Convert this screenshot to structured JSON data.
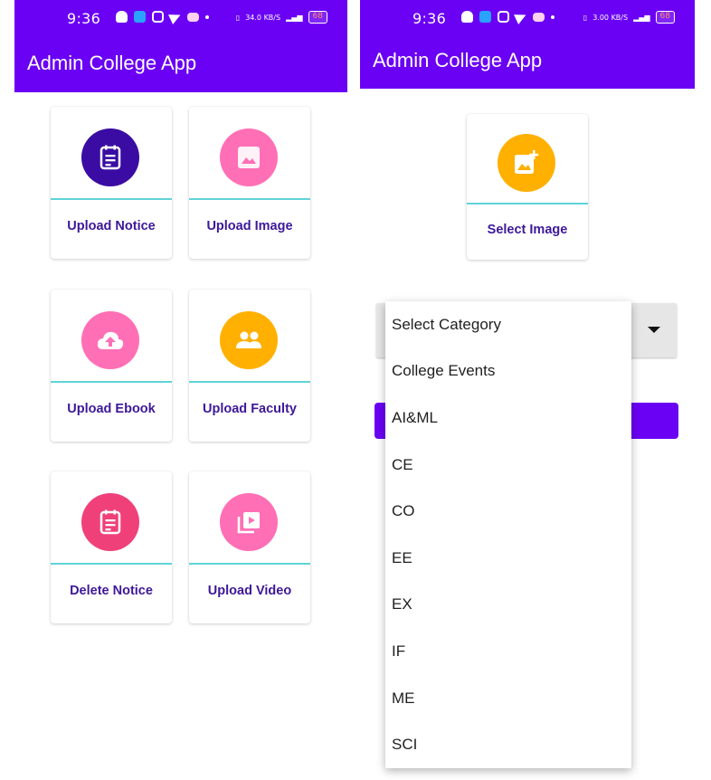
{
  "left": {
    "status": {
      "time": "9:36",
      "battery": "68",
      "speed": "34.0",
      "speed_unit": "KB/S"
    },
    "appbar": {
      "title": "Admin College App"
    },
    "cards": [
      {
        "label": "Upload Notice",
        "icon": "notice-icon",
        "color": "#3a0ca3"
      },
      {
        "label": "Upload Image",
        "icon": "image-icon",
        "color": "#ff6fb5"
      },
      {
        "label": "Upload Ebook",
        "icon": "cloud-upload-icon",
        "color": "#ff6fb5"
      },
      {
        "label": "Upload Faculty",
        "icon": "people-icon",
        "color": "#ffb000"
      },
      {
        "label": "Delete Notice",
        "icon": "notice-icon",
        "color": "#f0407a"
      },
      {
        "label": "Upload Video",
        "icon": "video-library-icon",
        "color": "#ff6fb5"
      }
    ]
  },
  "right": {
    "status": {
      "time": "9:36",
      "battery": "68",
      "speed": "3.00",
      "speed_unit": "KB/S"
    },
    "appbar": {
      "title": "Admin College App"
    },
    "select_card": {
      "label": "Select Image",
      "icon": "add-photo-icon",
      "color": "#ffb000"
    },
    "dropdown": {
      "options": [
        "Select Category",
        "College Events",
        "AI&ML",
        "CE",
        "CO",
        "EE",
        "EX",
        "IF",
        "ME",
        "SCI"
      ]
    }
  },
  "colors": {
    "primary": "#6a00f4",
    "divider": "#5fd3d9",
    "label": "#3d1899"
  }
}
